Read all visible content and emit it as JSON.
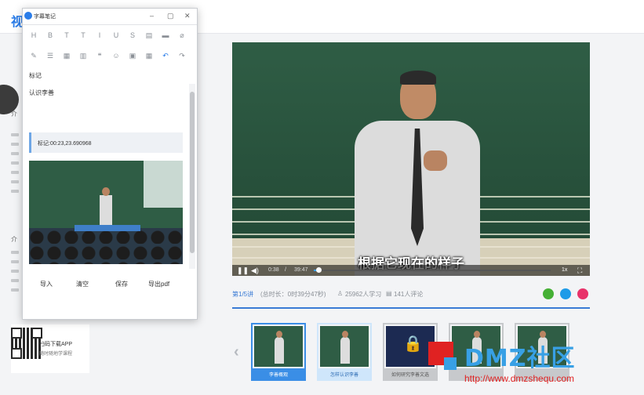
{
  "page": {
    "logo_char": "视"
  },
  "sidebar": {
    "intro_label_1": "介",
    "intro_label_2": "介"
  },
  "notes_window": {
    "title": "字幕笔记",
    "buttons": {
      "minimize": "–",
      "maximize": "▢",
      "close": "✕"
    },
    "toolbar": [
      "H",
      "B",
      "T",
      "T",
      "I",
      "U",
      "S",
      "▤",
      "▬",
      "⌀",
      "✎",
      "☰",
      "▦",
      "▥",
      "❝",
      "☺",
      "▣",
      "▦",
      "↶",
      "↷"
    ],
    "field_label": "标记",
    "text": "认识李善",
    "marker": "标记:00:23,23.690968",
    "actions": {
      "import": "导入",
      "clear": "清空",
      "save": "保存",
      "export_pdf": "导出pdf"
    }
  },
  "video": {
    "subtitle": "根据它现在的样子",
    "time_current": "0:38",
    "time_sep": "/",
    "time_total": "39:47",
    "speed": "1x",
    "progress": 0.02
  },
  "info": {
    "lecture": "第1/5讲",
    "duration": "(总时长：0时39分47秒)",
    "learners": "25962人学习",
    "comments": "141人评论"
  },
  "playlist": {
    "items": [
      {
        "caption": "李善概观",
        "active": true,
        "kind": "class"
      },
      {
        "caption": "怎样认识李善",
        "active": false,
        "kind": "class"
      },
      {
        "caption": "如何研究李善文选",
        "active": false,
        "kind": "lock"
      },
      {
        "caption": "",
        "active": false,
        "kind": "class"
      },
      {
        "caption": "",
        "active": false,
        "kind": "class"
      }
    ]
  },
  "app_promo": {
    "line1": "扫码下载APP",
    "line2": "随时随地学课程"
  },
  "watermark": {
    "brand": "DMZ社区",
    "url": "http://www.dmzshequ.com"
  },
  "colors": {
    "accent": "#3a7bd5",
    "watermark_red": "#e02222",
    "watermark_blue": "#38a0e5"
  }
}
